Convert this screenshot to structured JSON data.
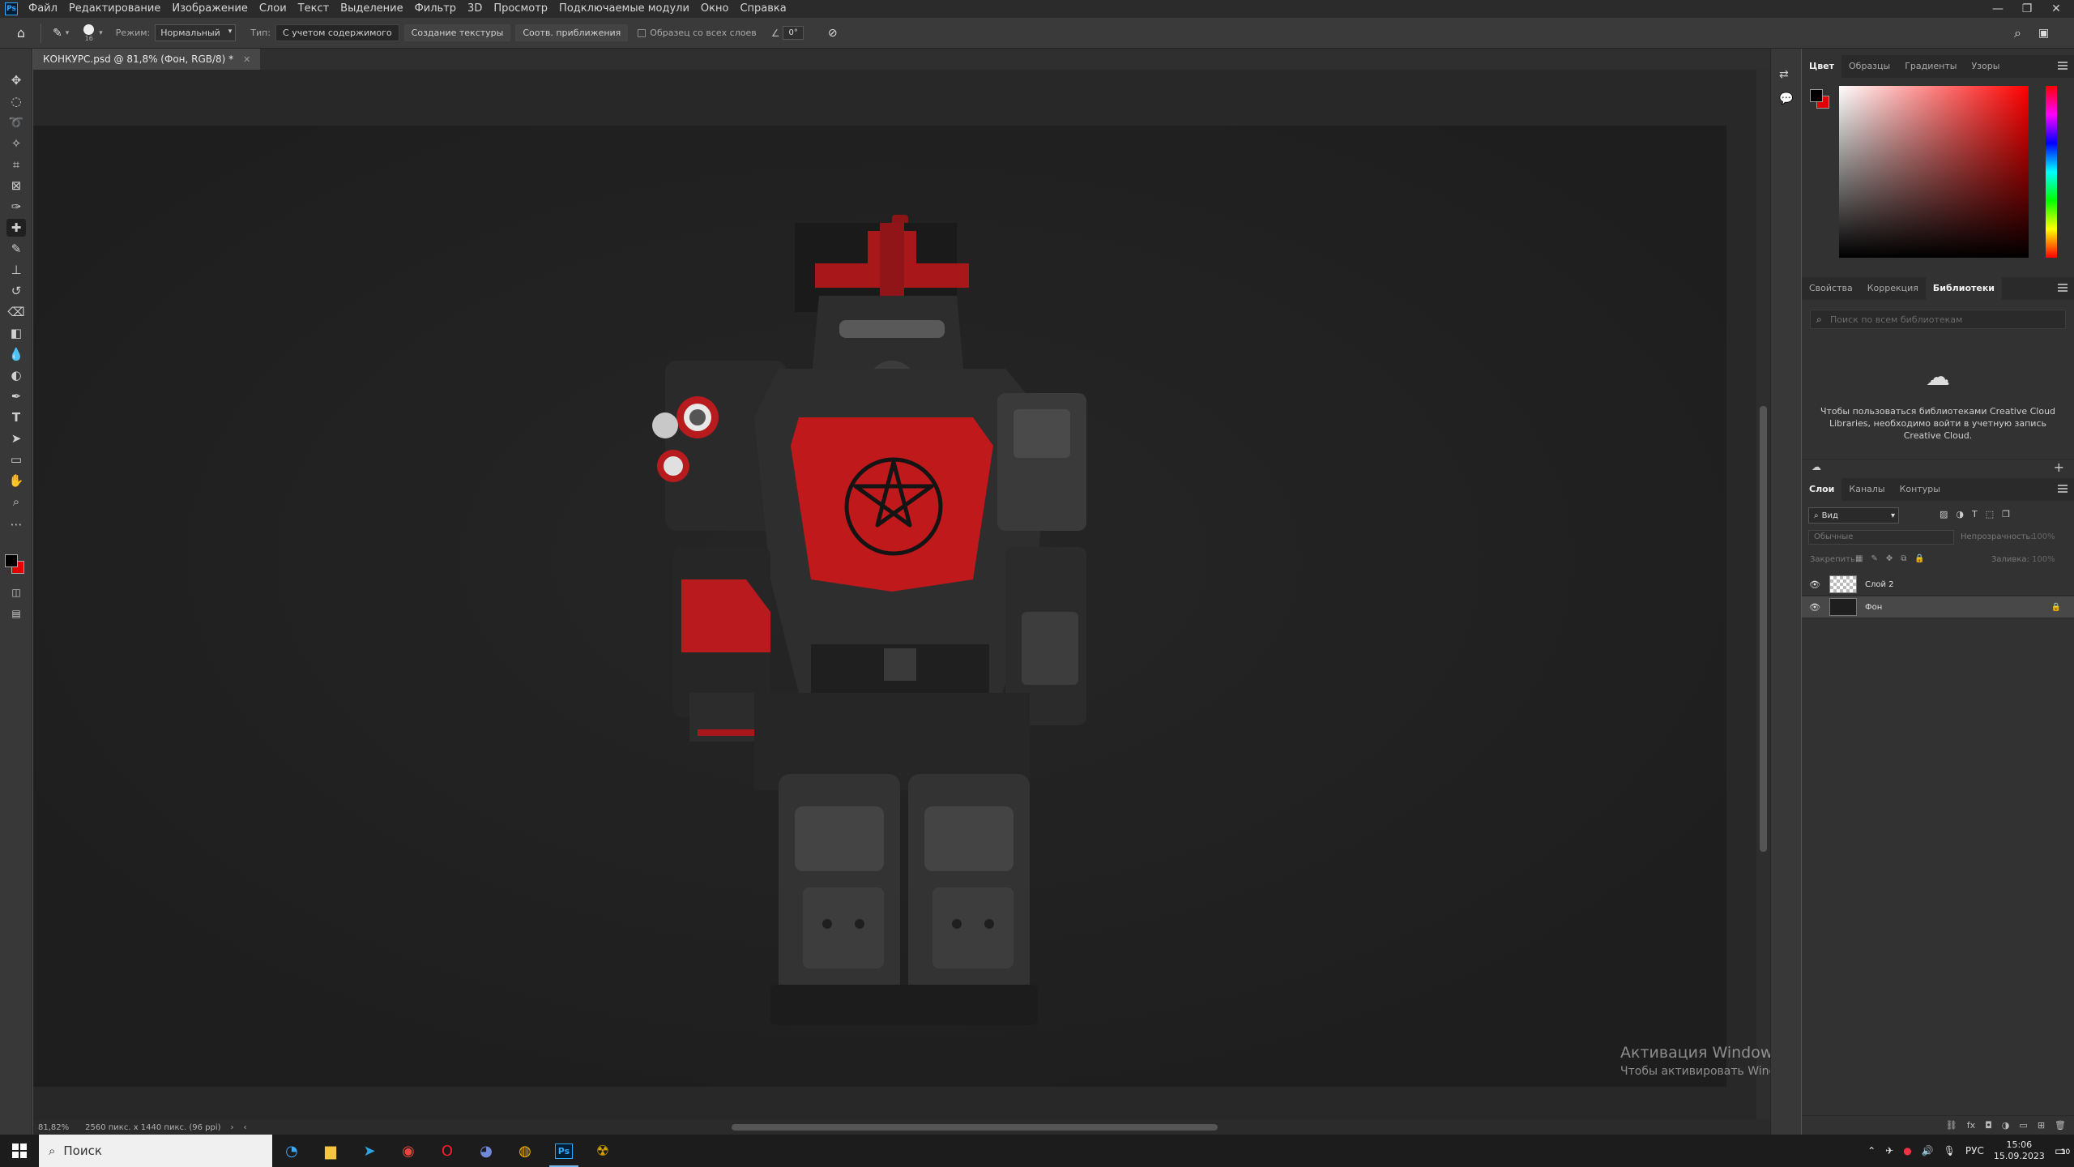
{
  "menubar": {
    "items": [
      "Файл",
      "Редактирование",
      "Изображение",
      "Слои",
      "Текст",
      "Выделение",
      "Фильтр",
      "3D",
      "Просмотр",
      "Подключаемые модули",
      "Окно",
      "Справка"
    ],
    "logo": "Ps"
  },
  "options": {
    "brush_size": "16",
    "mode_label": "Режим:",
    "mode_value": "Нормальный",
    "type_label": "Тип:",
    "type_content_aware": "С учетом содержимого",
    "type_texture": "Создание текстуры",
    "type_proximity": "Соотв. приближения",
    "sample_all_layers": "Образец со всех слоев",
    "angle": "0°"
  },
  "document": {
    "tab_title": "КОНКУРС.psd @ 81,8% (Фон, RGB/8) *"
  },
  "status": {
    "zoom": "81,82%",
    "doc_info": "2560 пикс. x 1440 пикс. (96 ppi)"
  },
  "color_panel": {
    "tabs": [
      "Цвет",
      "Образцы",
      "Градиенты",
      "Узоры"
    ],
    "foreground": "#000000",
    "background": "#e00000"
  },
  "libraries_panel": {
    "tabs": [
      "Свойства",
      "Коррекция",
      "Библиотеки"
    ],
    "search_placeholder": "Поиск по всем библиотекам",
    "message": "Чтобы пользоваться библиотеками Creative Cloud Libraries, необходимо войти в учетную запись Creative Cloud."
  },
  "layers_panel": {
    "tabs": [
      "Слои",
      "Каналы",
      "Контуры"
    ],
    "filter_kind": "Вид",
    "blend_mode": "Обычные",
    "opacity_label": "Непрозрачность:",
    "opacity_value": "100%",
    "lock_label": "Закрепить:",
    "fill_label": "Заливка:",
    "fill_value": "100%",
    "layers": [
      {
        "name": "Слой 2",
        "visible": true,
        "locked": false
      },
      {
        "name": "Фон",
        "visible": true,
        "locked": true
      }
    ]
  },
  "watermark": {
    "title": "Активация Windows",
    "subtitle": "Чтобы активировать Windows, перейдите в раздел \"Параметры\"."
  },
  "taskbar": {
    "search_placeholder": "Поиск",
    "language": "РУС",
    "time": "15:06",
    "date": "15.09.2023",
    "notification_count": "10"
  },
  "colors": {
    "accent": "#31a8ff",
    "armor_red": "#c0191c"
  }
}
